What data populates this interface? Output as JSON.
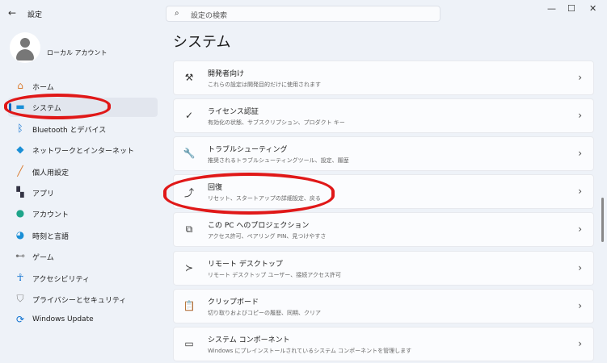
{
  "window": {
    "title": "設定",
    "search_placeholder": "設定の検索"
  },
  "account": {
    "name": "ローカル アカウント"
  },
  "sidebar": {
    "items": [
      {
        "label": "ホーム",
        "icon": "home-icon"
      },
      {
        "label": "システム",
        "icon": "system-icon",
        "selected": true
      },
      {
        "label": "Bluetooth とデバイス",
        "icon": "bluetooth-icon"
      },
      {
        "label": "ネットワークとインターネット",
        "icon": "wifi-icon"
      },
      {
        "label": "個人用設定",
        "icon": "brush-icon"
      },
      {
        "label": "アプリ",
        "icon": "apps-icon"
      },
      {
        "label": "アカウント",
        "icon": "account-icon"
      },
      {
        "label": "時刻と言語",
        "icon": "globe-clock-icon"
      },
      {
        "label": "ゲーム",
        "icon": "gamepad-icon"
      },
      {
        "label": "アクセシビリティ",
        "icon": "accessibility-icon"
      },
      {
        "label": "プライバシーとセキュリティ",
        "icon": "shield-icon"
      },
      {
        "label": "Windows Update",
        "icon": "update-icon"
      }
    ]
  },
  "main": {
    "title": "システム",
    "cards": [
      {
        "title": "開発者向け",
        "subtitle": "これらの設定は開発目的だけに使用されます",
        "icon": "developer-tools-icon"
      },
      {
        "title": "ライセンス認証",
        "subtitle": "有効化の状態、サブスクリプション、プロダクト キー",
        "icon": "check-circle-icon"
      },
      {
        "title": "トラブルシューティング",
        "subtitle": "推奨されるトラブルシューティングツール、設定、履歴",
        "icon": "wrench-icon"
      },
      {
        "title": "回復",
        "subtitle": "リセット、スタートアップの詳細設定、戻る",
        "icon": "recovery-icon"
      },
      {
        "title": "この PC へのプロジェクション",
        "subtitle": "アクセス許可、ペアリング PIN、見つけやすさ",
        "icon": "projection-icon"
      },
      {
        "title": "リモート デスクトップ",
        "subtitle": "リモート デスクトップ ユーザー、接続アクセス許可",
        "icon": "remote-desktop-icon"
      },
      {
        "title": "クリップボード",
        "subtitle": "切り取りおよびコピーの履歴、同期、クリア",
        "icon": "clipboard-icon"
      },
      {
        "title": "システム コンポーネント",
        "subtitle": "Windows にプレインストールされているシステム コンポーネントを管理します",
        "icon": "system-components-icon"
      }
    ]
  },
  "colors": {
    "accent": "#0067c0",
    "annotation": "#e01818"
  }
}
